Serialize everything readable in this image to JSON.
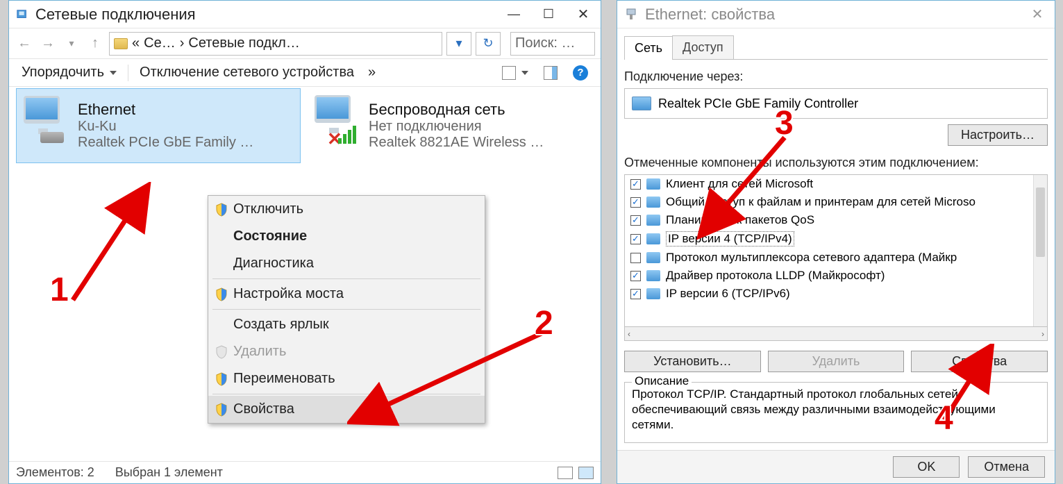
{
  "window1": {
    "title": "Сетевые подключения",
    "nav": {
      "back_disabled": true,
      "breadcrumb_1": "Се…",
      "breadcrumb_2": "Сетевые подкл…",
      "search_placeholder": "Поиск: …"
    },
    "cmdbar": {
      "organize": "Упорядочить",
      "disable": "Отключение сетевого устройства",
      "overflow": "»"
    },
    "connections": [
      {
        "name": "Ethernet",
        "status": "Ku-Ku",
        "adapter": "Realtek PCIe GbE Family …",
        "selected": true,
        "kind": "wired"
      },
      {
        "name": "Беспроводная сеть",
        "status": "Нет подключения",
        "adapter": "Realtek 8821AE Wireless …",
        "selected": false,
        "kind": "wifi_disconnected"
      }
    ],
    "context_menu": {
      "disable": "Отключить",
      "status": "Состояние",
      "diagnostics": "Диагностика",
      "bridge": "Настройка моста",
      "shortcut": "Создать ярлык",
      "delete": "Удалить",
      "rename": "Переименовать",
      "properties": "Свойства"
    },
    "statusbar": {
      "count": "Элементов: 2",
      "selected": "Выбран 1 элемент"
    }
  },
  "window2": {
    "title": "Ethernet: свойства",
    "tabs": {
      "network": "Сеть",
      "access": "Доступ"
    },
    "connect_via_label": "Подключение через:",
    "adapter_name": "Realtek PCIe GbE Family Controller",
    "configure_btn": "Настроить…",
    "components_label": "Отмеченные компоненты используются этим подключением:",
    "components": [
      {
        "checked": true,
        "label": "Клиент для сетей Microsoft"
      },
      {
        "checked": true,
        "label": "Общий доступ к файлам и принтерам для сетей Microso"
      },
      {
        "checked": true,
        "label": "Планировщик пакетов QoS"
      },
      {
        "checked": true,
        "label": "IP версии 4 (TCP/IPv4)",
        "selected": true
      },
      {
        "checked": false,
        "label": "Протокол мультиплексора сетевого адаптера (Майкр"
      },
      {
        "checked": true,
        "label": "Драйвер протокола LLDP (Майкрософт)"
      },
      {
        "checked": true,
        "label": "IP версии 6 (TCP/IPv6)"
      }
    ],
    "install_btn": "Установить…",
    "remove_btn": "Удалить",
    "properties_btn": "Свойства",
    "description_label": "Описание",
    "description_text": "Протокол TCP/IP. Стандартный протокол глобальных сетей, обеспечивающий связь между различными взаимодействующими сетями.",
    "ok_btn": "OK",
    "cancel_btn": "Отмена"
  },
  "annotations": {
    "step1": "1",
    "step2": "2",
    "step3": "3",
    "step4": "4"
  }
}
